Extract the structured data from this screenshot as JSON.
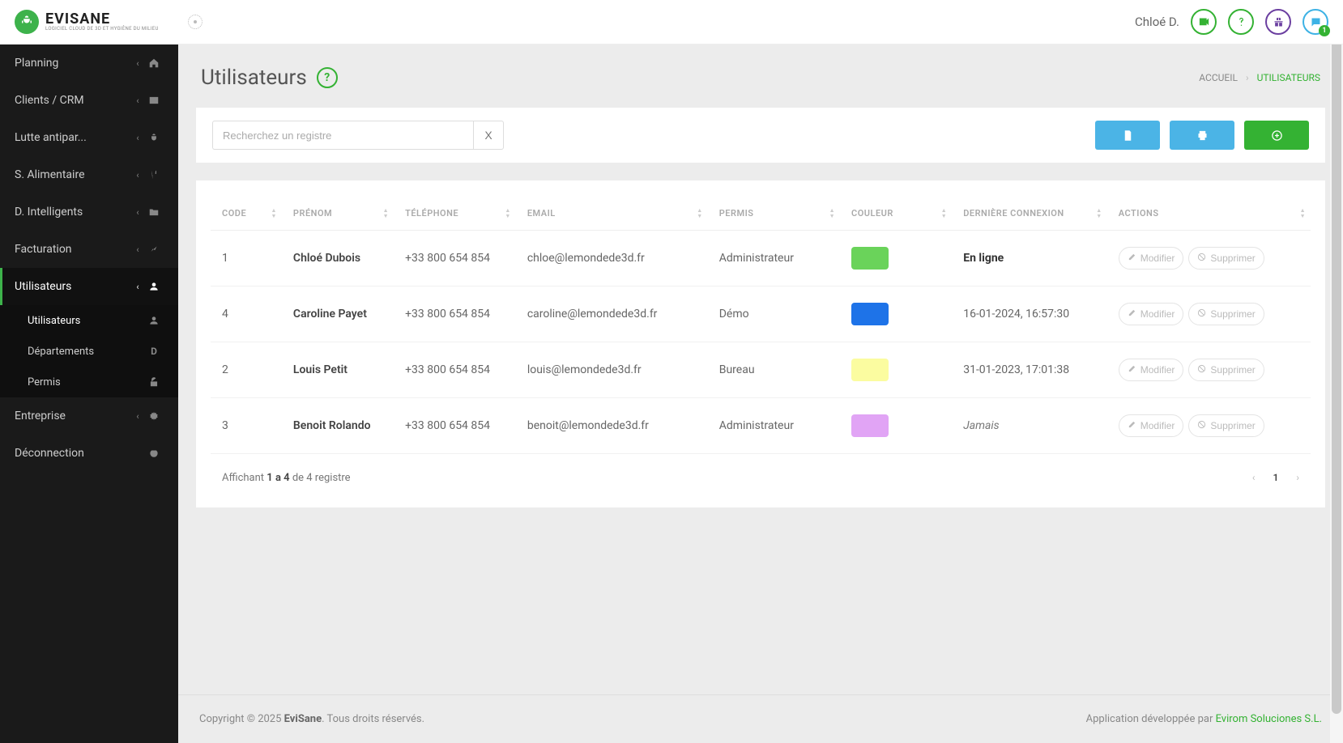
{
  "brand": {
    "name": "EVISANE",
    "tagline": "LOGICIEL CLOUD DE 3D ET HYGIÈNE DU MILIEU"
  },
  "user": {
    "display_name": "Chloé D.",
    "chat_badge": "1"
  },
  "sidebar": {
    "items": [
      {
        "label": "Planning",
        "icon": "home"
      },
      {
        "label": "Clients / CRM",
        "icon": "id-card"
      },
      {
        "label": "Lutte antipar...",
        "icon": "bug"
      },
      {
        "label": "S. Alimentaire",
        "icon": "utensils"
      },
      {
        "label": "D. Intelligents",
        "icon": "folder"
      },
      {
        "label": "Facturation",
        "icon": "chart"
      },
      {
        "label": "Utilisateurs",
        "icon": "user",
        "active": true
      },
      {
        "label": "Entreprise",
        "icon": "gear"
      },
      {
        "label": "Déconnection",
        "icon": "power",
        "no_chevron": true
      }
    ],
    "sub_users": [
      {
        "label": "Utilisateurs",
        "icon": "user",
        "active": true
      },
      {
        "label": "Départements",
        "icon_text": "D"
      },
      {
        "label": "Permis",
        "icon": "lock-open"
      }
    ]
  },
  "page": {
    "title": "Utilisateurs",
    "breadcrumb_home": "ACCUEIL",
    "breadcrumb_current": "UTILISATEURS"
  },
  "toolbar": {
    "search_placeholder": "Recherchez un registre",
    "clear_label": "X"
  },
  "table": {
    "headers": {
      "code": "CODE",
      "prenom": "PRÉNOM",
      "telephone": "TÉLÉPHONE",
      "email": "EMAIL",
      "permis": "PERMIS",
      "couleur": "COULEUR",
      "derniere": "DERNIÈRE CONNEXION",
      "actions": "ACTIONS"
    },
    "rows": [
      {
        "code": "1",
        "prenom": "Chloé Dubois",
        "telephone": "+33 800 654 854",
        "email": "chloe@lemondede3d.fr",
        "permis": "Administrateur",
        "color": "#6ad35a",
        "derniere": "En ligne",
        "online": true
      },
      {
        "code": "4",
        "prenom": "Caroline Payet",
        "telephone": "+33 800 654 854",
        "email": "caroline@lemondede3d.fr",
        "permis": "Démo",
        "color": "#1e73e8",
        "derniere": "16-01-2024, 16:57:30"
      },
      {
        "code": "2",
        "prenom": "Louis Petit",
        "telephone": "+33 800 654 854",
        "email": "louis@lemondede3d.fr",
        "permis": "Bureau",
        "color": "#fbfca0",
        "derniere": "31-01-2023, 17:01:38"
      },
      {
        "code": "3",
        "prenom": "Benoit Rolando",
        "telephone": "+33 800 654 854",
        "email": "benoit@lemondede3d.fr",
        "permis": "Administrateur",
        "color": "#e1a4f5",
        "derniere": "Jamais",
        "never": true
      }
    ],
    "action_edit": "Modifier",
    "action_delete": "Supprimer"
  },
  "table_footer": {
    "showing_pre": "Affichant ",
    "showing_range": "1 a 4",
    "showing_post": " de 4 registre",
    "page": "1"
  },
  "footer": {
    "copyright_pre": "Copyright © 2025 ",
    "copyright_brand": "EviSane",
    "copyright_post": ". Tous droits réservés.",
    "app_by_pre": "Application développée par ",
    "app_by_link": "Evirom Soluciones S.L."
  }
}
